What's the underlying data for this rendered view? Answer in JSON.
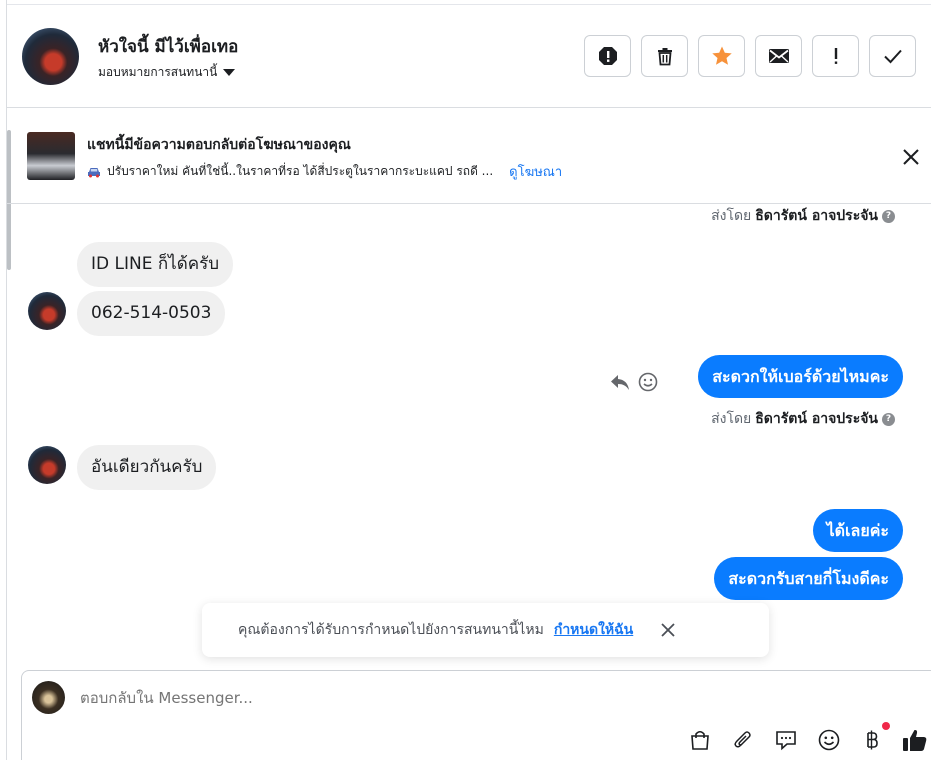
{
  "header": {
    "contact_name": "หัวใจนี้ มีไว้เพื่อเทอ",
    "assign_label": "มอบหมายการสนทนานี้"
  },
  "ad": {
    "title": "แชทนี้มีข้อความตอบกลับต่อโฆษณาของคุณ",
    "subtitle": "ปรับราคาใหม่ คันที่ใช่นี้..ในราคาที่รอ ได้สี่ประตูในราคากระบะแคป รถดี ...",
    "link": "ดูโฆษณา"
  },
  "messages": {
    "meta1": {
      "prefix": "ส่งโดย",
      "sender": "ธิดารัตน์ อาจประจัน"
    },
    "in1": "ID LINE ก็ได้ครับ",
    "in2": "062-514-0503",
    "out1": "สะดวกให้เบอร์ด้วยไหมคะ",
    "meta2": {
      "prefix": "ส่งโดย",
      "sender": "ธิดารัตน์ อาจประจัน"
    },
    "in3": "อันเดียวกันครับ",
    "out2": "ได้เลยค่ะ",
    "out3": "สะดวกรับสายกี่โมงดีคะ"
  },
  "toast": {
    "text": "คุณต้องการได้รับการกำหนดไปยังการสนทนานี้ไหม",
    "link": "กำหนดให้ฉัน"
  },
  "composer": {
    "placeholder": "ตอบกลับใน Messenger..."
  },
  "colors": {
    "accent": "#0a7cff",
    "link": "#1877f2",
    "star": "#f7923b",
    "notification": "#f02849"
  }
}
